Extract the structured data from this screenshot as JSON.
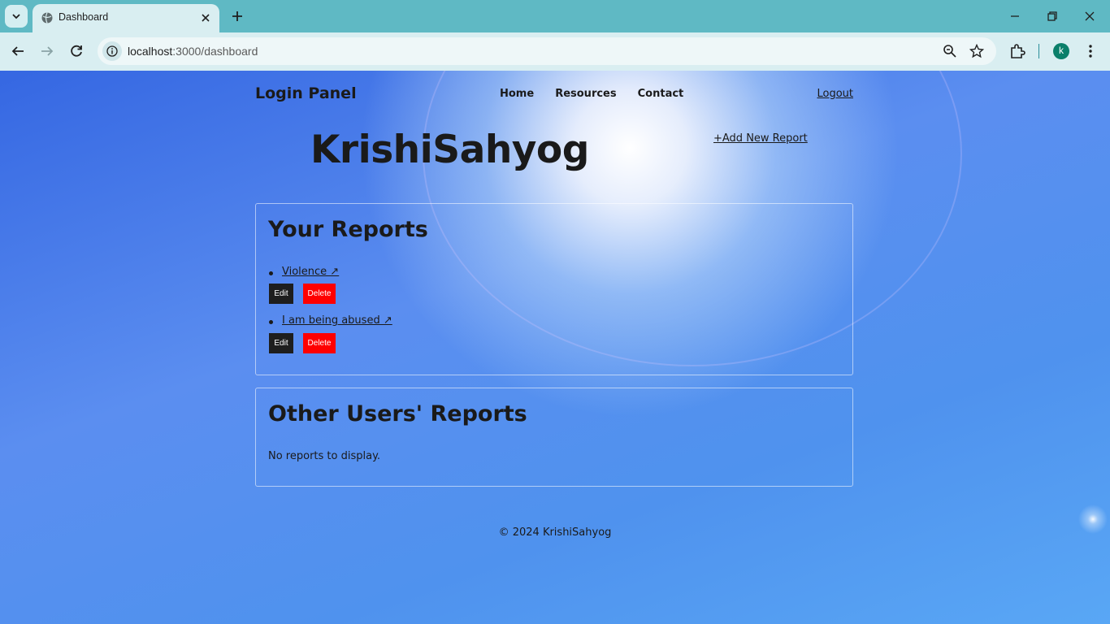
{
  "browser": {
    "tab_title": "Dashboard",
    "url_host": "localhost",
    "url_path": ":3000/dashboard",
    "profile_initial": "k"
  },
  "site": {
    "brand": "Login Panel",
    "nav": [
      "Home",
      "Resources",
      "Contact"
    ],
    "logout": "Logout",
    "title": "KrishiSahyog",
    "add_report": "+Add New Report"
  },
  "your_reports": {
    "heading": "Your Reports",
    "items": [
      {
        "title": "Violence ↗",
        "edit": "Edit",
        "delete": "Delete"
      },
      {
        "title": "I am being abused ↗",
        "edit": "Edit",
        "delete": "Delete"
      }
    ]
  },
  "other_reports": {
    "heading": "Other Users' Reports",
    "empty": "No reports to display."
  },
  "footer": "© 2024 KrishiSahyog",
  "colors": {
    "tabstrip": "#5fb9c4",
    "toolbar": "#d9eef1",
    "delete_button": "#ff0000",
    "edit_button": "#1e1e1e"
  }
}
